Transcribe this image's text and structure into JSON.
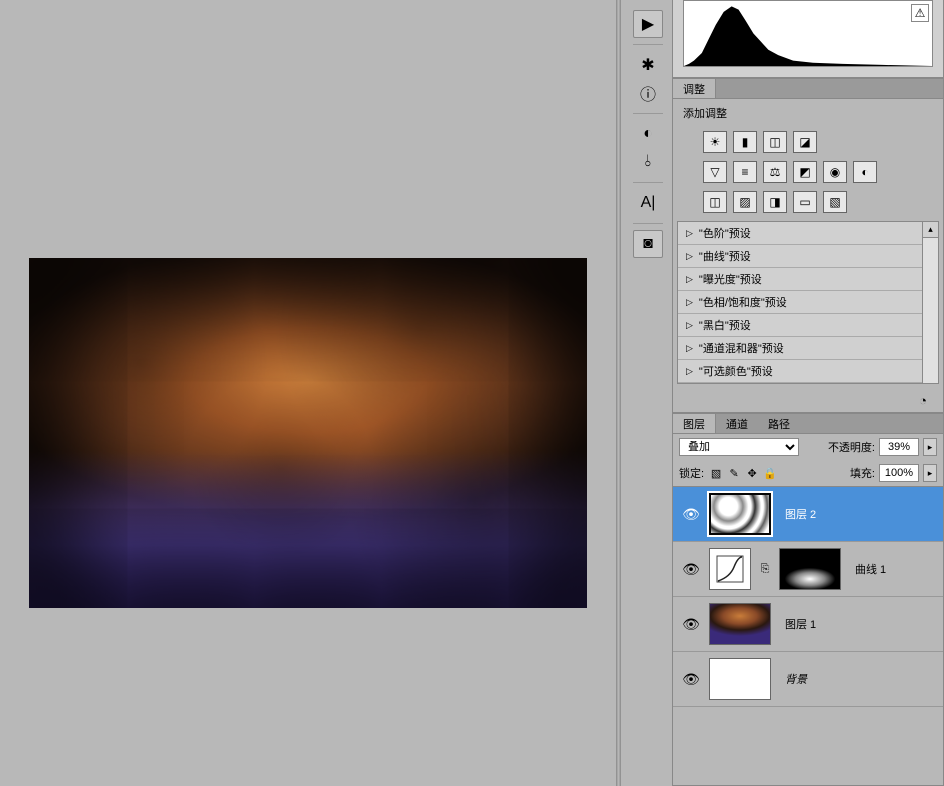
{
  "panels": {
    "adjustments": {
      "tab_label": "调整",
      "title": "添加调整",
      "presets": [
        {
          "label": "\"色阶\"预设"
        },
        {
          "label": "\"曲线\"预设"
        },
        {
          "label": "\"曝光度\"预设"
        },
        {
          "label": "\"色相/饱和度\"预设"
        },
        {
          "label": "\"黑白\"预设"
        },
        {
          "label": "\"通道混和器\"预设"
        },
        {
          "label": "\"可选颜色\"预设"
        }
      ]
    },
    "layers": {
      "tabs": {
        "layers": "图层",
        "channels": "通道",
        "paths": "路径"
      },
      "blend_mode": "叠加",
      "opacity_label": "不透明度:",
      "opacity_value": "39%",
      "lock_label": "锁定:",
      "fill_label": "填充:",
      "fill_value": "100%",
      "items": [
        {
          "name": "图层 2",
          "type": "clouds",
          "selected": true
        },
        {
          "name": "曲线 1",
          "type": "curves"
        },
        {
          "name": "图层 1",
          "type": "gradient"
        },
        {
          "name": "背景",
          "type": "bg"
        }
      ]
    }
  },
  "icons": {
    "play": "▶",
    "helm": "✱",
    "info": "ⓘ",
    "color": "◐",
    "connector": "⫰",
    "text": "A|",
    "camera": "◙",
    "brightness": "☀",
    "levels": "▮",
    "curves": "◫",
    "exposure": "◪",
    "vibrance": "▽",
    "hsl": "≡",
    "balance": "⚖",
    "bw": "◩",
    "photo": "◉",
    "lut": "◐",
    "invert": "◫",
    "posterize": "▨",
    "threshold": "◨",
    "gradient": "▭",
    "selective": "▧",
    "mask_ring": "◔",
    "warning": "⚠"
  }
}
